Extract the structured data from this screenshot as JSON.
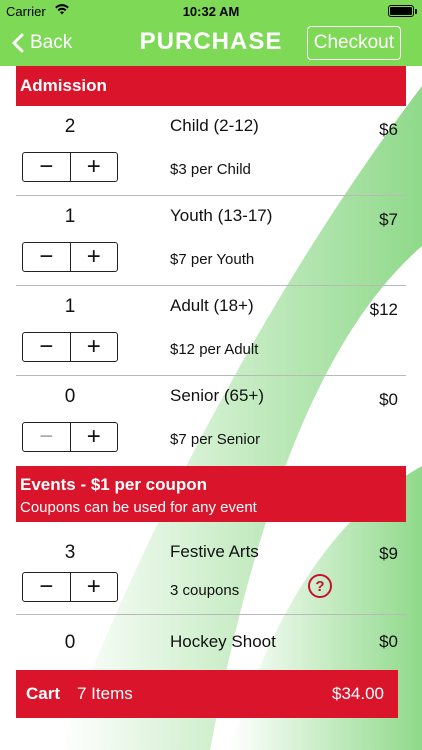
{
  "status": {
    "carrier": "Carrier",
    "time": "10:32 AM"
  },
  "nav": {
    "back_label": "Back",
    "title": "PURCHASE",
    "checkout_label": "Checkout"
  },
  "admission": {
    "header": "Admission",
    "rows": [
      {
        "qty": "2",
        "name": "Child (2-12)",
        "unit": "$3 per Child",
        "price": "$6"
      },
      {
        "qty": "1",
        "name": "Youth (13-17)",
        "unit": "$7 per Youth",
        "price": "$7"
      },
      {
        "qty": "1",
        "name": "Adult (18+)",
        "unit": "$12 per Adult",
        "price": "$12"
      },
      {
        "qty": "0",
        "name": "Senior (65+)",
        "unit": "$7 per Senior",
        "price": "$0"
      }
    ]
  },
  "events": {
    "header": "Events - $1 per coupon",
    "subheader": "Coupons can be used for any event",
    "rows": [
      {
        "qty": "3",
        "name": "Festive Arts",
        "unit": "3 coupons",
        "price": "$9",
        "help": "?"
      },
      {
        "qty": "0",
        "name": "Hockey Shoot",
        "price": "$0"
      }
    ]
  },
  "stepper": {
    "minus": "−",
    "plus": "+"
  },
  "cart": {
    "label": "Cart",
    "items": "7 Items",
    "total": "$34.00"
  },
  "colors": {
    "green": "#7ed957",
    "red": "#d9142b"
  }
}
